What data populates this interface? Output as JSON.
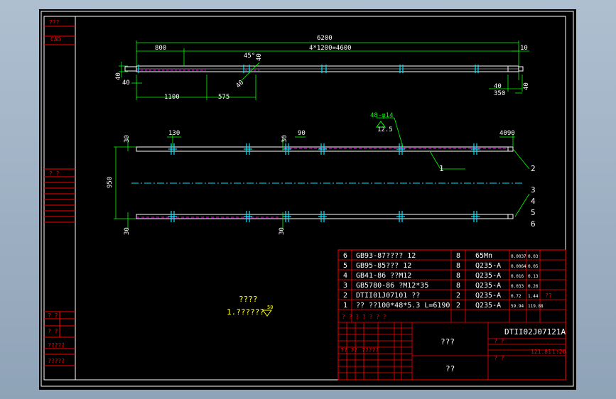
{
  "drawing_number": "DTII02J07121A",
  "left_strip": {
    "label_1": "???",
    "label_2": "CAD",
    "label_3": "?  ?",
    "label_4": "?  ?",
    "label_5": "?  ?",
    "label_6": "?????",
    "label_7": "?????"
  },
  "top_view": {
    "dims": {
      "overall": "6200",
      "left": "800",
      "middle": "4*1200=4600",
      "right": "10",
      "bevel": "45°",
      "bevel_size": "40",
      "bevel_size_2": "40",
      "h_left": "40",
      "h_left_2": "40",
      "bottom_1": "1100",
      "bottom_2": "575",
      "right_1": "40",
      "right_2": "350",
      "right_3": "40"
    }
  },
  "plan_view": {
    "hole_note": "48-φ14",
    "hole_tol": "12.5",
    "dims": {
      "d130": "130",
      "d30a": "30",
      "d30b": "30",
      "d90": "90",
      "d4090": "4090",
      "width": "950",
      "d30c": "30",
      "d30d": "30"
    },
    "callouts": [
      "1",
      "2",
      "3",
      "4",
      "5",
      "6"
    ]
  },
  "tech_note": {
    "line1": "????",
    "line2": "1.??????",
    "roughness": "50"
  },
  "parts_table": {
    "rows": [
      {
        "no": "6",
        "code": "GB93-87????  12",
        "qty": "8",
        "material": "65Mn",
        "w1": "0.0037",
        "w2": "0.03"
      },
      {
        "no": "5",
        "code": "GB95-85???  12",
        "qty": "8",
        "material": "Q235-A",
        "w1": "0.0064",
        "w2": "0.05"
      },
      {
        "no": "4",
        "code": "GB41-86 ??M12",
        "qty": "8",
        "material": "Q235-A",
        "w1": "0.016",
        "w2": "0.13"
      },
      {
        "no": "3",
        "code": "GB5780-86 ?M12*35",
        "qty": "8",
        "material": "Q235-A",
        "w1": "0.033",
        "w2": "0.26"
      },
      {
        "no": "2",
        "code": "DTII01J07101 ??",
        "qty": "2",
        "material": "Q235-A",
        "w1": "0.72",
        "w2": "1.44"
      },
      {
        "no": "1",
        "code": "??   ??100*48*5.3 L=6190",
        "qty": "2",
        "material": "Q235-A",
        "w1": "59.94",
        "w2": "119.88"
      }
    ],
    "extra_right": "??",
    "header": [
      "?",
      "?",
      "?",
      "?",
      "?",
      "?",
      "?"
    ]
  },
  "title_block": {
    "title": "???",
    "company": "??",
    "total_weight": "121.81",
    "scale": "1:20",
    "mini": "??  ??",
    "mini_2": "?????",
    "mini_3": "?  ?",
    "mini_4": "?  ?"
  }
}
